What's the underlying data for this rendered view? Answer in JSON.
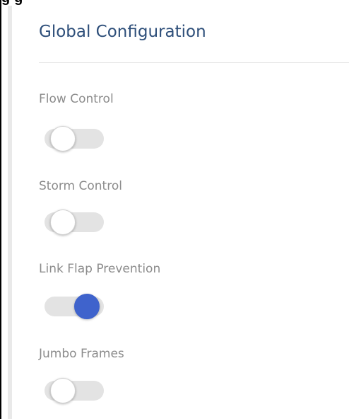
{
  "header": {
    "cut_title": "g                                               g"
  },
  "panel": {
    "title": "Global Configuration"
  },
  "settings": [
    {
      "label": "Flow Control",
      "enabled": false
    },
    {
      "label": "Storm Control",
      "enabled": false
    },
    {
      "label": "Link Flap Prevention",
      "enabled": true
    },
    {
      "label": "Jumbo Frames",
      "enabled": false
    }
  ],
  "colors": {
    "title": "#2e4f7a",
    "label": "#8c8c8c",
    "toggle_on": "#3f63cc",
    "toggle_track": "#e3e3e3"
  }
}
